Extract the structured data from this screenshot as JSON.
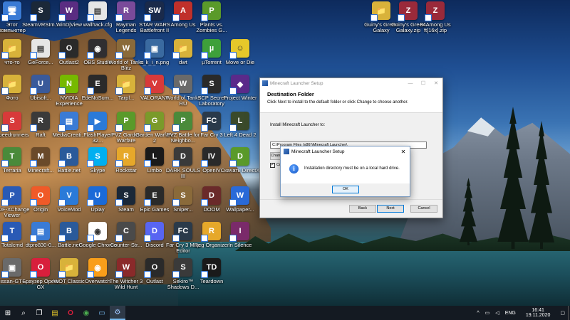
{
  "desktop_icons": [
    {
      "label": "Этот компьютер",
      "glyph": "🖥",
      "color": "#3a7bd5"
    },
    {
      "label": "SteamVRSIm...",
      "glyph": "S",
      "color": "#1b2838"
    },
    {
      "label": "WinDjView",
      "glyph": "W",
      "color": "#5a2d82"
    },
    {
      "label": "wallhack.cfg",
      "glyph": "▤",
      "color": "#e6e6e6"
    },
    {
      "label": "Rayman Legends",
      "glyph": "R",
      "color": "#7a4a9a"
    },
    {
      "label": "STAR WARS Battlefront II",
      "glyph": "SW",
      "color": "#1a2a4a"
    },
    {
      "label": "Among Us",
      "glyph": "A",
      "color": "#c0302a"
    },
    {
      "label": "Plants vs. Zombies G...",
      "glyph": "P",
      "color": "#5a9a2a"
    },
    {
      "label": "Guiny's Green Galaxy",
      "glyph": "📁",
      "color": "#d8b23a"
    },
    {
      "label": "Guiny's Green Galaxy.zip",
      "glyph": "Z",
      "color": "#9a2a3a"
    },
    {
      "label": "84Among Us ft[16x].zip",
      "glyph": "Z",
      "color": "#9a2a3a"
    },
    {
      "label": "что-то",
      "glyph": "📁",
      "color": "#d8b23a"
    },
    {
      "label": "GeForce...",
      "glyph": "▤",
      "color": "#e6e6e6"
    },
    {
      "label": "Outlast2",
      "glyph": "O",
      "color": "#2a2a2a"
    },
    {
      "label": "OBS Studio",
      "glyph": "◉",
      "color": "#302e31"
    },
    {
      "label": "World of Tanks Blitz",
      "glyph": "W",
      "color": "#8a6a3a"
    },
    {
      "label": "s_k_i_n.png",
      "glyph": "▣",
      "color": "#3a6aa0"
    },
    {
      "label": "dwt",
      "glyph": "📁",
      "color": "#d8b23a"
    },
    {
      "label": "µTorrent",
      "glyph": "µ",
      "color": "#3ea03a"
    },
    {
      "label": "Move or Die",
      "glyph": "☺",
      "color": "#e6c82a"
    },
    {
      "label": "Фото",
      "glyph": "📁",
      "color": "#d8b23a"
    },
    {
      "label": "Ubisoft...",
      "glyph": "U",
      "color": "#3a5a9a"
    },
    {
      "label": "NVIDIA Experience",
      "glyph": "N",
      "color": "#76b900"
    },
    {
      "label": "EdeNoSum...",
      "glyph": "E",
      "color": "#2a2a2a"
    },
    {
      "label": "Tarpl...",
      "glyph": "📁",
      "color": "#d8b23a"
    },
    {
      "label": "VALORANT",
      "glyph": "V",
      "color": "#d83a3a"
    },
    {
      "label": "World of Tanks RU",
      "glyph": "W",
      "color": "#6a6a6a"
    },
    {
      "label": "SCP Secret Laboratory",
      "glyph": "S",
      "color": "#2a2a2a"
    },
    {
      "label": "Project Winter",
      "glyph": "◆",
      "color": "#5a2a8a"
    },
    {
      "label": "Speedrunners",
      "glyph": "S",
      "color": "#d83a3a"
    },
    {
      "label": "Raft",
      "glyph": "R",
      "color": "#3a3a3a"
    },
    {
      "label": "MediaCreati...",
      "glyph": "▤",
      "color": "#3a7bd5"
    },
    {
      "label": "FlashPlayer 32...",
      "glyph": "▶",
      "color": "#2a7ad8"
    },
    {
      "label": "PVZ Garden Warfare",
      "glyph": "P",
      "color": "#5a9a2a"
    },
    {
      "label": "Garden Warfare 2",
      "glyph": "G",
      "color": "#7a9a2a"
    },
    {
      "label": "PVZ Battle for Neighbo...",
      "glyph": "P",
      "color": "#4a8a3a"
    },
    {
      "label": "Far Cry 3",
      "glyph": "FC",
      "color": "#2a3a4a"
    },
    {
      "label": "Left 4 Dead 2",
      "glyph": "L",
      "color": "#3a4a2a"
    },
    {
      "label": "Terraria",
      "glyph": "T",
      "color": "#4a8a3a"
    },
    {
      "label": "Minecraft...",
      "glyph": "M",
      "color": "#6a4a2a"
    },
    {
      "label": "Battle.net",
      "glyph": "B",
      "color": "#2a5a9a"
    },
    {
      "label": "Skype",
      "glyph": "S",
      "color": "#00aff0"
    },
    {
      "label": "Rockstar",
      "glyph": "R",
      "color": "#e6a82a"
    },
    {
      "label": "Limbo",
      "glyph": "L",
      "color": "#1a1a1a"
    },
    {
      "label": "DARK SOULS III",
      "glyph": "D",
      "color": "#3a3a3a"
    },
    {
      "label": "OpenIV",
      "glyph": "IV",
      "color": "#2a2a2a"
    },
    {
      "label": "Скачать DirectX",
      "glyph": "D",
      "color": "#5a9a2a"
    },
    {
      "label": "PDF-XChange Viewer",
      "glyph": "P",
      "color": "#2a5ab5"
    },
    {
      "label": "Origin",
      "glyph": "O",
      "color": "#f05a28"
    },
    {
      "label": "VoiceMod",
      "glyph": "V",
      "color": "#2a7ad8"
    },
    {
      "label": "Uplay",
      "glyph": "U",
      "color": "#1a6ad8"
    },
    {
      "label": "Steam",
      "glyph": "S",
      "color": "#1b2838"
    },
    {
      "label": "Epic Games",
      "glyph": "E",
      "color": "#2a2a2a"
    },
    {
      "label": "Sniper...",
      "glyph": "S",
      "color": "#8a6a3a"
    },
    {
      "label": "DOOM",
      "glyph": "D",
      "color": "#6a2a2a"
    },
    {
      "label": "Wallpaper...",
      "glyph": "W",
      "color": "#2a6ad8"
    },
    {
      "label": "Totalcmd",
      "glyph": "T",
      "color": "#2a5ab5"
    },
    {
      "label": "dtpro830-0...",
      "glyph": "▤",
      "color": "#3a7bd5"
    },
    {
      "label": "Battle.net",
      "glyph": "B",
      "color": "#2a5a9a"
    },
    {
      "label": "Google Chrome",
      "glyph": "◉",
      "color": "#ffffff"
    },
    {
      "label": "Counter-Str...",
      "glyph": "C",
      "color": "#4a4a4a"
    },
    {
      "label": "Discord",
      "glyph": "D",
      "color": "#5865f2"
    },
    {
      "label": "Far Cry 3 Map Editor",
      "glyph": "FC",
      "color": "#2a3a4a"
    },
    {
      "label": "Reg Organizer",
      "glyph": "R",
      "color": "#e6a82a"
    },
    {
      "label": "In Silence",
      "glyph": "I",
      "color": "#7a2a6a"
    },
    {
      "label": "Nissan-GT-...",
      "glyph": "▣",
      "color": "#6a6a6a"
    },
    {
      "label": "Браузер Opera GX",
      "glyph": "O",
      "color": "#d81f3c"
    },
    {
      "label": "WOT Classic",
      "glyph": "📁",
      "color": "#d8b23a"
    },
    {
      "label": "Overwatch",
      "glyph": "◉",
      "color": "#f99e1a"
    },
    {
      "label": "The Witcher 3 Wild Hunt",
      "glyph": "W",
      "color": "#8a2a2a"
    },
    {
      "label": "Outlast",
      "glyph": "O",
      "color": "#2a2a2a"
    },
    {
      "label": "Sekiro™ Shadows D...",
      "glyph": "S",
      "color": "#3a3a3a"
    },
    {
      "label": "Teardown",
      "glyph": "TD",
      "color": "#1a1a1a"
    }
  ],
  "installer": {
    "title": "Minecraft Launcher Setup",
    "header_title": "Destination Folder",
    "header_desc": "Click Next to install to the default folder or click Change to choose another.",
    "install_label": "Install Minecraft Launcher to:",
    "path_value": "C:\\Program Files (x86)\\Minecraft Launcher\\",
    "change_label": "Change...",
    "checkbox_label": "Cr...",
    "checkbox_mark": "✓",
    "back_label": "Back",
    "next_label": "Next",
    "cancel_label": "Cancel",
    "minimize": "—",
    "maximize": "☐",
    "close": "✕"
  },
  "msgbox": {
    "title": "Minecraft Launcher Setup",
    "message": "Installation directory must be on a local hard drive.",
    "ok_label": "OK",
    "close": "✕",
    "icon_glyph": "i"
  },
  "taskbar": {
    "start": "⊞",
    "search": "⌕",
    "taskview": "❐",
    "apps": [
      "▤",
      "O",
      "◉",
      "▭",
      "⚙"
    ],
    "tray_chevron": "^",
    "lang": "ENG",
    "time": "16:41",
    "date": "19.11.2020"
  }
}
